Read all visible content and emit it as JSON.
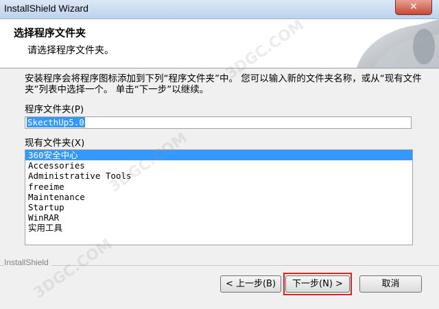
{
  "window": {
    "title": "InstallShield Wizard",
    "close_glyph": "✕"
  },
  "header": {
    "title": "选择程序文件夹",
    "subtitle": "请选择程序文件夹。"
  },
  "instructions": "安装程序会将程序图标添加到下列“程序文件夹”中。 您可以输入新的文件夹名称，或从“现有文件夹”列表中选择一个。 单击“下一步”以继续。",
  "program_folder": {
    "label": "程序文件夹(P)",
    "value": "SkecthUp5.0"
  },
  "existing_folders": {
    "label": "现有文件夹(X)",
    "items": [
      "360安全中心",
      "Accessories",
      "Administrative Tools",
      "freeime",
      "Maintenance",
      "Startup",
      "WinRAR",
      "实用工具"
    ],
    "selected": "360安全中心"
  },
  "brand": "InstallShield",
  "buttons": {
    "back": "< 上一步(B)",
    "next": "下一步(N) >",
    "cancel": "取消"
  },
  "watermark_text": "3DGC.COM"
}
